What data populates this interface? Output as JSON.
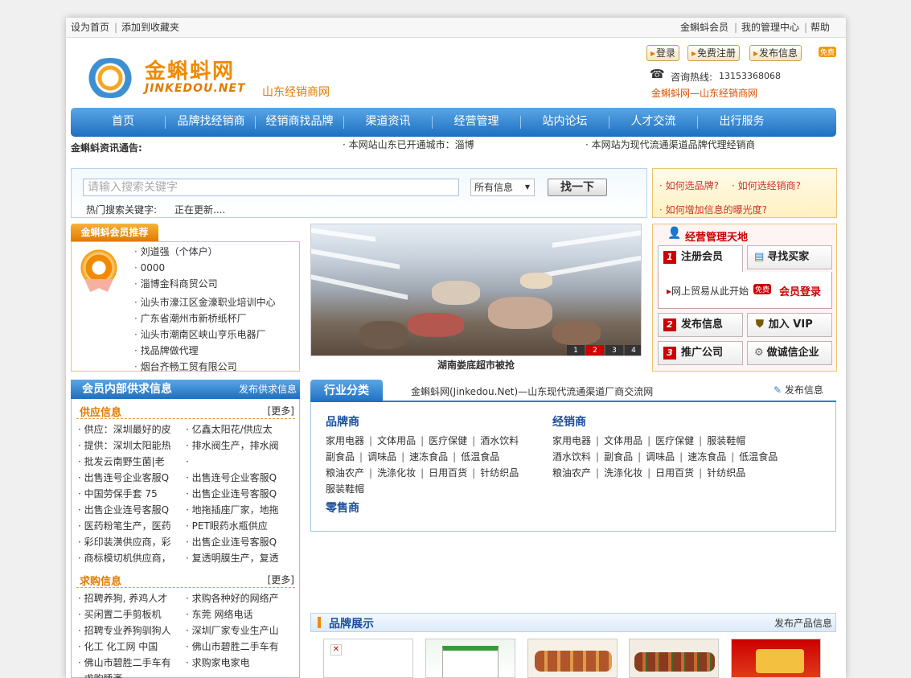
{
  "topbar": {
    "left": [
      "设为首页",
      "添加到收藏夹"
    ],
    "right": [
      "金蝌蚪会员",
      "我的管理中心",
      "帮助"
    ]
  },
  "header": {
    "logo_cn": "金蝌蚪网",
    "logo_en": "JINKEDOU.NET",
    "site_title": "山东经销商网",
    "login": "登录",
    "register": "免费注册",
    "publish": "发布信息",
    "free_badge": "免费",
    "hotline_label": "咨询热线:",
    "hotline": "13153368068",
    "slogan": "金蝌蚪网—山东经销商网"
  },
  "nav": [
    "首页",
    "品牌找经销商",
    "经销商找品牌",
    "渠道资讯",
    "经营管理",
    "站内论坛",
    "人才交流",
    "出行服务"
  ],
  "notice": {
    "label": "金蝌蚪资讯通告:",
    "items": [
      "· 本网站山东已开通城市：淄博",
      "· 本网站为现代流通渠道品牌代理经销商"
    ]
  },
  "search": {
    "placeholder": "请输入搜索关键字",
    "select": "所有信息",
    "button": "找一下",
    "hot_label": "热门搜索关键字:",
    "hot_value": "正在更新...."
  },
  "faq": [
    "· 如何选品牌?",
    "· 如何选经销商?",
    "· 如何增加信息的曝光度?"
  ],
  "members": {
    "title": "金蝌蚪会员推荐",
    "items": [
      "刘道强（个体户）",
      "0000",
      "淄博金科商贸公司",
      "汕头市濠江区金濠职业培训中心",
      "广东省潮州市新桥纸杯厂",
      "汕头市潮南区峡山亨乐电器厂",
      "找品牌做代理",
      "烟台齐畅工贸有限公司"
    ]
  },
  "photo": {
    "caption": "湖南娄底超市被抢",
    "pages": [
      "1",
      "2",
      "3",
      "4"
    ]
  },
  "manage": {
    "title": "经营管理天地",
    "register": "注册会员",
    "find_buyer": "寻找买家",
    "trade_text": "网上贸易从此开始",
    "free_badge": "免费",
    "member_login": "会员登录",
    "publish": "发布信息",
    "vip": "加入 VIP",
    "promote": "推广公司",
    "honest": "做诚信企业",
    "n1": "1",
    "n2": "2",
    "n3": "3"
  },
  "supply": {
    "title": "会员内部供求信息",
    "publish": "发布供求信息",
    "supply_title": "供应信息",
    "more": "[更多]",
    "supply_left": [
      "· 供应：深圳最好的皮",
      "· 提供：深圳太阳能热",
      "· 批发云南野生菌|老",
      "· 出售连号企业客服Q",
      "· 中国劳保手套 75",
      "· 出售企业连号客服Q",
      "· 医药粉笔生产，医药",
      "· 彩印装潢供应商，彩",
      "· 商标模切机供应商，"
    ],
    "supply_right": [
      "· 亿鑫太阳花/供应太",
      "· 排水阀生产，排水阀",
      "·",
      "· 出售连号企业客服Q",
      "· 出售企业连号客服Q",
      "· 地拖插座厂家，地拖",
      "· PET眼药水瓶供应",
      "· 出售企业连号客服Q",
      "· 复透明膜生产，复透"
    ],
    "buy_title": "求购信息",
    "buy_left": [
      "· 招聘养狗, 养鸡人才",
      "· 买闲置二手剪板机",
      "· 招聘专业养狗驯狗人",
      "· 化工 化工网 中国",
      "· 佛山市碧胜二手车有",
      "· 求购睡袤"
    ],
    "buy_right": [
      "· 求购各种好的网络产",
      "· 东莞 网络电话",
      "· 深圳厂家专业生产山",
      "· 佛山市碧胜二手车有",
      "· 求购家电家电"
    ]
  },
  "category": {
    "tab": "行业分类",
    "subtitle": "金蝌蚪网(Jinkedou.Net)—山东现代流通渠道厂商交流网",
    "publish": "发布信息",
    "brand_title": "品牌商",
    "dealer_title": "经销商",
    "retail_title": "零售商",
    "brand_rows": [
      [
        "家用电器",
        "文体用品",
        "医疗保健",
        "酒水饮料"
      ],
      [
        "副食品",
        "调味品",
        "速冻食品",
        "低温食品"
      ],
      [
        "粮油农产",
        "洗涤化妆",
        "日用百货",
        "针纺织品"
      ],
      [
        "服装鞋帽"
      ]
    ],
    "dealer_rows": [
      [
        "家用电器",
        "文体用品",
        "医疗保健",
        "服装鞋帽"
      ],
      [
        "酒水饮料",
        "副食品",
        "调味品",
        "速冻食品",
        "低温食品"
      ],
      [
        "粮油农产",
        "洗涤化妆",
        "日用百货",
        "针纺织品"
      ]
    ]
  },
  "brand_show": {
    "title": "品牌展示",
    "publish": "发布产品信息"
  }
}
